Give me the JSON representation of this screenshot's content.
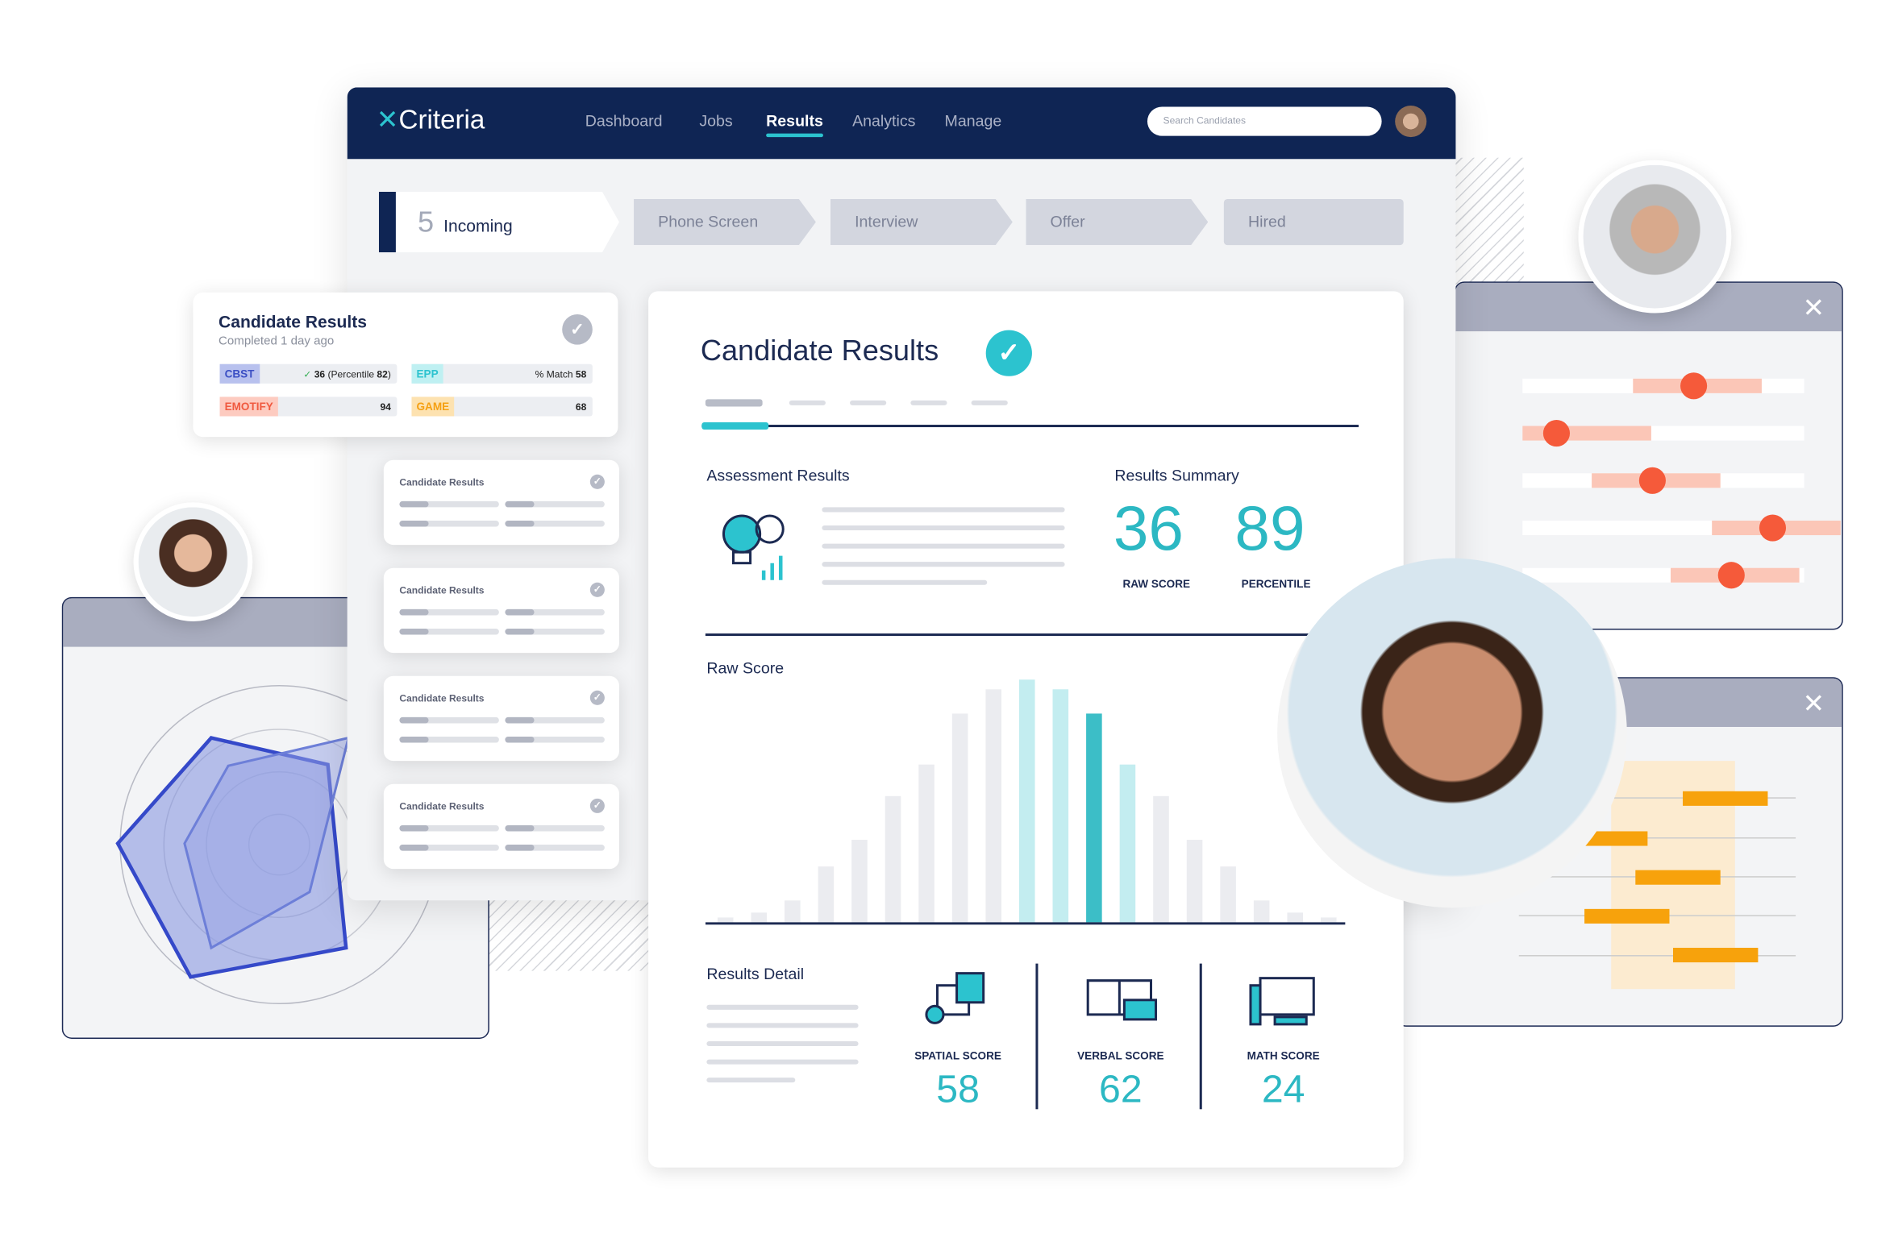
{
  "brand": {
    "name": "Criteria",
    "accent": "#2cc3cf",
    "navy": "#0f2554"
  },
  "nav": {
    "items": [
      {
        "label": "Dashboard"
      },
      {
        "label": "Jobs"
      },
      {
        "label": "Results",
        "active": true
      },
      {
        "label": "Analytics"
      },
      {
        "label": "Manage"
      }
    ],
    "search_placeholder": "Search Candidates"
  },
  "pipeline": {
    "incoming_count": "5",
    "stages": [
      {
        "label": "Incoming"
      },
      {
        "label": "Phone Screen"
      },
      {
        "label": "Interview"
      },
      {
        "label": "Offer"
      },
      {
        "label": "Hired"
      }
    ]
  },
  "summary_card": {
    "title": "Candidate Results",
    "subtitle": "Completed 1 day ago",
    "tests": [
      {
        "tag": "CBST",
        "value": "36",
        "extra_prefix": "(Percentile ",
        "extra_value": "82",
        "extra_suffix": ")",
        "color": "#3b4fc4",
        "bg": "#b8c1ee"
      },
      {
        "tag": "EPP",
        "prefix": "% Match ",
        "value": "58",
        "color": "#2cc3cf",
        "bg": "#bff0f2"
      },
      {
        "tag": "EMOTIFY",
        "value": "94",
        "color": "#f05a40",
        "bg": "#fdcbc0"
      },
      {
        "tag": "GAME",
        "value": "68",
        "color": "#f5a012",
        "bg": "#fde2b0"
      }
    ]
  },
  "mini_cards": [
    {
      "title": "Candidate Results"
    },
    {
      "title": "Candidate Results"
    },
    {
      "title": "Candidate Results"
    },
    {
      "title": "Candidate Results"
    }
  ],
  "main": {
    "title": "Candidate Results",
    "assessment_results": "Assessment Results",
    "results_summary": {
      "label": "Results Summary",
      "raw_score": "36",
      "raw_score_label": "RAW SCORE",
      "percentile": "89",
      "percentile_label": "PERCENTILE"
    },
    "raw_score": {
      "label": "Raw Score",
      "distribution": [
        2,
        4,
        9,
        23,
        34,
        52,
        65,
        86,
        96,
        100,
        96,
        86,
        65,
        52,
        34,
        23,
        9,
        4,
        2
      ],
      "highlight_index": 11,
      "light_indices": [
        9,
        10,
        12
      ]
    },
    "results_detail": {
      "label": "Results Detail",
      "scores": [
        {
          "label": "SPATIAL SCORE",
          "value": "58",
          "icon": "blocks-icon"
        },
        {
          "label": "VERBAL SCORE",
          "value": "62",
          "icon": "book-chat-icon"
        },
        {
          "label": "MATH SCORE",
          "value": "24",
          "icon": "math-board-icon"
        }
      ]
    }
  },
  "slider_panel": {
    "values": [
      0.6,
      0.1,
      0.45,
      0.89,
      0.74
    ]
  },
  "close_label": "✕"
}
